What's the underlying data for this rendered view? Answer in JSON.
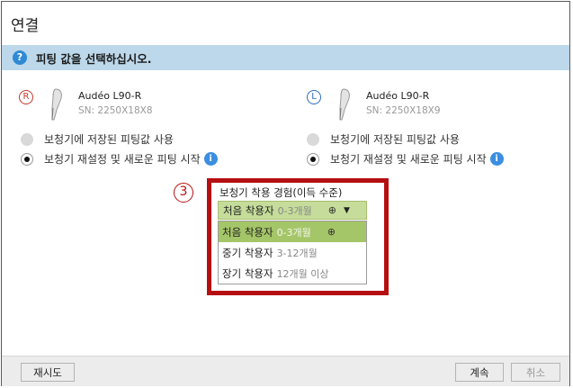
{
  "window": {
    "title": "연결"
  },
  "info_bar": {
    "icon": "?",
    "text": "피팅 값을 선택하십시오."
  },
  "devices": {
    "right": {
      "side_glyph": "R",
      "name": "Audéo L90-R",
      "sn": "SN: 2250X18X8"
    },
    "left": {
      "side_glyph": "L",
      "name": "Audéo L90-R",
      "sn": "SN: 2250X18X9"
    }
  },
  "options": {
    "use_stored": "보청기에 저장된 피팅값 사용",
    "reset_new": "보청기 재설정 및 새로운 피팅 시작",
    "info_glyph": "i",
    "right_selected": "reset_new",
    "left_selected": "reset_new"
  },
  "experience": {
    "step_number": "③",
    "label": "보청기 착용 경험(이득 수준)",
    "selected": {
      "label": "처음 착용자",
      "range": "0-3개월"
    },
    "items": [
      {
        "label": "처음 착용자",
        "range": "0-3개월",
        "selected": true
      },
      {
        "label": "중기 착용자",
        "range": "3-12개월",
        "selected": false
      },
      {
        "label": "장기 착용자",
        "range": "12개월 이상",
        "selected": false
      }
    ]
  },
  "footer": {
    "retry": "재시도",
    "continue": "계속",
    "cancel": "취소"
  },
  "colors": {
    "accent_red": "#b50f12",
    "info_bar": "#bcd8ea",
    "selection_green": "#a5c668",
    "right_ear": "#c0392b",
    "left_ear": "#2a6fb8"
  },
  "icons": {
    "info": "question-icon",
    "device": "hearing-aid-icon",
    "globe": "globe-icon",
    "dropdown": "chevron-down-icon"
  }
}
